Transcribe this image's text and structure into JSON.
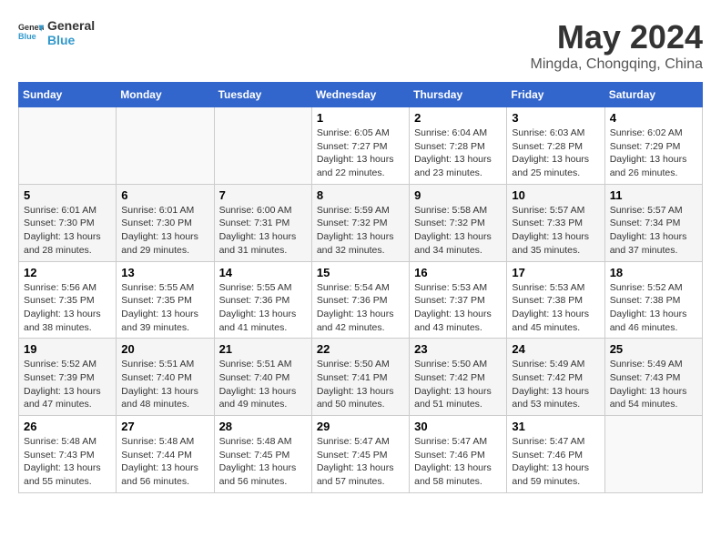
{
  "header": {
    "logo_text_1": "General",
    "logo_text_2": "Blue",
    "month_year": "May 2024",
    "location": "Mingda, Chongqing, China"
  },
  "weekdays": [
    "Sunday",
    "Monday",
    "Tuesday",
    "Wednesday",
    "Thursday",
    "Friday",
    "Saturday"
  ],
  "weeks": [
    [
      {
        "day": "",
        "info": ""
      },
      {
        "day": "",
        "info": ""
      },
      {
        "day": "",
        "info": ""
      },
      {
        "day": "1",
        "info": "Sunrise: 6:05 AM\nSunset: 7:27 PM\nDaylight: 13 hours\nand 22 minutes."
      },
      {
        "day": "2",
        "info": "Sunrise: 6:04 AM\nSunset: 7:28 PM\nDaylight: 13 hours\nand 23 minutes."
      },
      {
        "day": "3",
        "info": "Sunrise: 6:03 AM\nSunset: 7:28 PM\nDaylight: 13 hours\nand 25 minutes."
      },
      {
        "day": "4",
        "info": "Sunrise: 6:02 AM\nSunset: 7:29 PM\nDaylight: 13 hours\nand 26 minutes."
      }
    ],
    [
      {
        "day": "5",
        "info": "Sunrise: 6:01 AM\nSunset: 7:30 PM\nDaylight: 13 hours\nand 28 minutes."
      },
      {
        "day": "6",
        "info": "Sunrise: 6:01 AM\nSunset: 7:30 PM\nDaylight: 13 hours\nand 29 minutes."
      },
      {
        "day": "7",
        "info": "Sunrise: 6:00 AM\nSunset: 7:31 PM\nDaylight: 13 hours\nand 31 minutes."
      },
      {
        "day": "8",
        "info": "Sunrise: 5:59 AM\nSunset: 7:32 PM\nDaylight: 13 hours\nand 32 minutes."
      },
      {
        "day": "9",
        "info": "Sunrise: 5:58 AM\nSunset: 7:32 PM\nDaylight: 13 hours\nand 34 minutes."
      },
      {
        "day": "10",
        "info": "Sunrise: 5:57 AM\nSunset: 7:33 PM\nDaylight: 13 hours\nand 35 minutes."
      },
      {
        "day": "11",
        "info": "Sunrise: 5:57 AM\nSunset: 7:34 PM\nDaylight: 13 hours\nand 37 minutes."
      }
    ],
    [
      {
        "day": "12",
        "info": "Sunrise: 5:56 AM\nSunset: 7:35 PM\nDaylight: 13 hours\nand 38 minutes."
      },
      {
        "day": "13",
        "info": "Sunrise: 5:55 AM\nSunset: 7:35 PM\nDaylight: 13 hours\nand 39 minutes."
      },
      {
        "day": "14",
        "info": "Sunrise: 5:55 AM\nSunset: 7:36 PM\nDaylight: 13 hours\nand 41 minutes."
      },
      {
        "day": "15",
        "info": "Sunrise: 5:54 AM\nSunset: 7:36 PM\nDaylight: 13 hours\nand 42 minutes."
      },
      {
        "day": "16",
        "info": "Sunrise: 5:53 AM\nSunset: 7:37 PM\nDaylight: 13 hours\nand 43 minutes."
      },
      {
        "day": "17",
        "info": "Sunrise: 5:53 AM\nSunset: 7:38 PM\nDaylight: 13 hours\nand 45 minutes."
      },
      {
        "day": "18",
        "info": "Sunrise: 5:52 AM\nSunset: 7:38 PM\nDaylight: 13 hours\nand 46 minutes."
      }
    ],
    [
      {
        "day": "19",
        "info": "Sunrise: 5:52 AM\nSunset: 7:39 PM\nDaylight: 13 hours\nand 47 minutes."
      },
      {
        "day": "20",
        "info": "Sunrise: 5:51 AM\nSunset: 7:40 PM\nDaylight: 13 hours\nand 48 minutes."
      },
      {
        "day": "21",
        "info": "Sunrise: 5:51 AM\nSunset: 7:40 PM\nDaylight: 13 hours\nand 49 minutes."
      },
      {
        "day": "22",
        "info": "Sunrise: 5:50 AM\nSunset: 7:41 PM\nDaylight: 13 hours\nand 50 minutes."
      },
      {
        "day": "23",
        "info": "Sunrise: 5:50 AM\nSunset: 7:42 PM\nDaylight: 13 hours\nand 51 minutes."
      },
      {
        "day": "24",
        "info": "Sunrise: 5:49 AM\nSunset: 7:42 PM\nDaylight: 13 hours\nand 53 minutes."
      },
      {
        "day": "25",
        "info": "Sunrise: 5:49 AM\nSunset: 7:43 PM\nDaylight: 13 hours\nand 54 minutes."
      }
    ],
    [
      {
        "day": "26",
        "info": "Sunrise: 5:48 AM\nSunset: 7:43 PM\nDaylight: 13 hours\nand 55 minutes."
      },
      {
        "day": "27",
        "info": "Sunrise: 5:48 AM\nSunset: 7:44 PM\nDaylight: 13 hours\nand 56 minutes."
      },
      {
        "day": "28",
        "info": "Sunrise: 5:48 AM\nSunset: 7:45 PM\nDaylight: 13 hours\nand 56 minutes."
      },
      {
        "day": "29",
        "info": "Sunrise: 5:47 AM\nSunset: 7:45 PM\nDaylight: 13 hours\nand 57 minutes."
      },
      {
        "day": "30",
        "info": "Sunrise: 5:47 AM\nSunset: 7:46 PM\nDaylight: 13 hours\nand 58 minutes."
      },
      {
        "day": "31",
        "info": "Sunrise: 5:47 AM\nSunset: 7:46 PM\nDaylight: 13 hours\nand 59 minutes."
      },
      {
        "day": "",
        "info": ""
      }
    ]
  ]
}
